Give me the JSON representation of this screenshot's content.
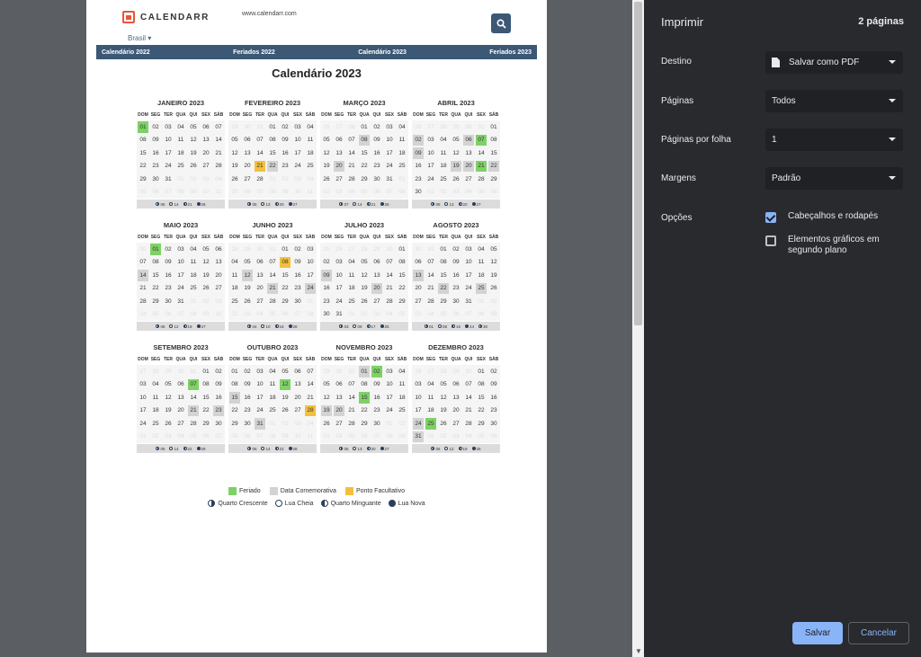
{
  "site": {
    "logo": "CALENDARR",
    "url": "www.calendarr.com",
    "country": "Brasil ▾"
  },
  "nav": [
    "Calendário 2022",
    "Feriados 2022",
    "Calendário 2023",
    "Feriados 2023"
  ],
  "calendar_title": "Calendário 2023",
  "weekdays": [
    "DOM",
    "SEG",
    "TER",
    "QUA",
    "QUI",
    "SEX",
    "SÁB"
  ],
  "months": [
    {
      "name": "JANEIRO 2023",
      "first": 0,
      "days": 31,
      "prev_days": 31,
      "marks": {
        "1": "h"
      },
      "moons": [
        "06",
        "14",
        "21",
        "28"
      ]
    },
    {
      "name": "FEVEREIRO 2023",
      "first": 3,
      "days": 28,
      "prev_days": 31,
      "marks": {
        "21": "f",
        "22": "c"
      },
      "moons": [
        "05",
        "13",
        "20",
        "27"
      ]
    },
    {
      "name": "MARÇO 2023",
      "first": 3,
      "days": 31,
      "prev_days": 28,
      "marks": {
        "8": "c",
        "20": "c"
      },
      "moons": [
        "07",
        "14",
        "21",
        "28"
      ]
    },
    {
      "name": "ABRIL 2023",
      "first": 6,
      "days": 30,
      "prev_days": 31,
      "marks": {
        "2": "c",
        "6": "c",
        "7": "h",
        "9": "c",
        "19": "c",
        "20": "c",
        "21": "h",
        "22": "c"
      },
      "moons": [
        "06",
        "13",
        "20",
        "27"
      ]
    },
    {
      "name": "MAIO 2023",
      "first": 1,
      "days": 31,
      "prev_days": 30,
      "marks": {
        "1": "h",
        "14": "c"
      },
      "moons": [
        "05",
        "12",
        "19",
        "27"
      ]
    },
    {
      "name": "JUNHO 2023",
      "first": 4,
      "days": 30,
      "prev_days": 31,
      "marks": {
        "8": "f",
        "12": "c",
        "21": "c",
        "24": "c"
      },
      "moons": [
        "04",
        "10",
        "18",
        "26"
      ]
    },
    {
      "name": "JULHO 2023",
      "first": 6,
      "days": 31,
      "prev_days": 30,
      "marks": {
        "9": "c",
        "20": "c"
      },
      "moons": [
        "03",
        "09",
        "17",
        "25"
      ]
    },
    {
      "name": "AGOSTO 2023",
      "first": 2,
      "days": 31,
      "prev_days": 31,
      "marks": {
        "13": "c",
        "22": "c",
        "25": "c"
      },
      "moons": [
        "01",
        "08",
        "16",
        "24",
        "30"
      ]
    },
    {
      "name": "SETEMBRO 2023",
      "first": 5,
      "days": 30,
      "prev_days": 31,
      "marks": {
        "7": "h",
        "21": "c",
        "23": "c"
      },
      "moons": [
        "06",
        "14",
        "22",
        "29"
      ]
    },
    {
      "name": "OUTUBRO 2023",
      "first": 0,
      "days": 31,
      "prev_days": 30,
      "marks": {
        "12": "h",
        "15": "c",
        "28": "f",
        "31": "c"
      },
      "moons": [
        "06",
        "14",
        "22",
        "28"
      ]
    },
    {
      "name": "NOVEMBRO 2023",
      "first": 3,
      "days": 30,
      "prev_days": 31,
      "marks": {
        "1": "c",
        "2": "h",
        "15": "h",
        "19": "c",
        "20": "c"
      },
      "moons": [
        "05",
        "13",
        "20",
        "27"
      ]
    },
    {
      "name": "DEZEMBRO 2023",
      "first": 5,
      "days": 31,
      "prev_days": 30,
      "marks": {
        "24": "c",
        "25": "h",
        "31": "c"
      },
      "moons": [
        "05",
        "12",
        "19",
        "26"
      ]
    }
  ],
  "legend": {
    "feriado": "Feriado",
    "comemorativa": "Data Comemorativa",
    "facultativo": "Ponto Facultativo",
    "crescente": "Quarto Crescente",
    "cheia": "Lua Cheia",
    "minguante": "Quarto Minguante",
    "nova": "Lua Nova"
  },
  "colors": {
    "feriado": "#7ed265",
    "comemorativa": "#d3d3d3",
    "facultativo": "#f3c03d",
    "nav": "#3c5875",
    "panel": "#292a2d",
    "accent": "#8ab4f8"
  },
  "print": {
    "title": "Imprimir",
    "pages_count": "2 páginas",
    "destino_label": "Destino",
    "destino_value": "Salvar como PDF",
    "paginas_label": "Páginas",
    "paginas_value": "Todos",
    "por_folha_label": "Páginas por folha",
    "por_folha_value": "1",
    "margens_label": "Margens",
    "margens_value": "Padrão",
    "opcoes_label": "Opções",
    "opt_headers": "Cabeçalhos e rodapés",
    "opt_headers_checked": true,
    "opt_graphics": "Elementos gráficos em segundo plano",
    "opt_graphics_checked": false,
    "save": "Salvar",
    "cancel": "Cancelar"
  }
}
